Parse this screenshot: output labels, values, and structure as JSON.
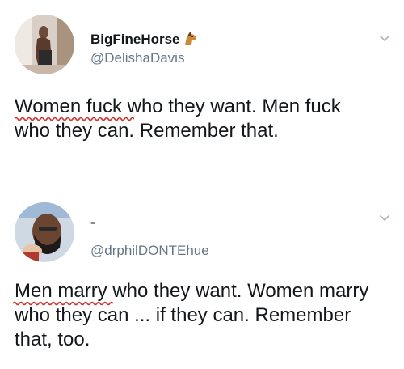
{
  "tweets": [
    {
      "display_name": "BigFineHorse",
      "display_name_emoji": "horse-face-icon",
      "handle": "@DelishaDavis",
      "text": "Women fuck who they want. Men fuck\nwho they can. Remember that.",
      "avatar_icon": "user-avatar-icon",
      "menu_icon": "chevron-down-icon"
    },
    {
      "display_name": "-",
      "handle": "@drphilDONTEhue",
      "text": "Men marry who they want. Women marry\nwho they can ... if they can. Remember\nthat, too.",
      "avatar_icon": "user-avatar-icon",
      "menu_icon": "chevron-down-icon"
    }
  ],
  "colors": {
    "text": "#14171a",
    "handle": "#657786",
    "spellcheck_underline": "#d0312d",
    "chevron": "#aab8c2"
  }
}
